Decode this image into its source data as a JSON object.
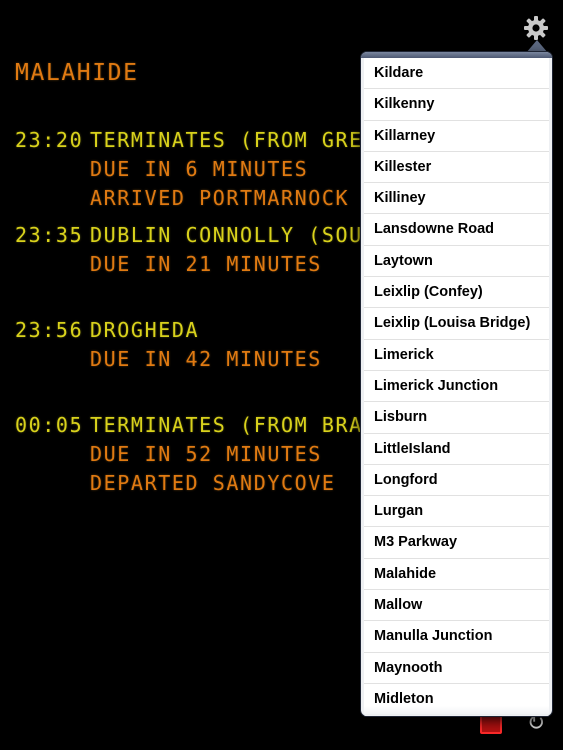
{
  "board": {
    "station": "MALAHIDE",
    "departures": [
      {
        "time": "23:20",
        "destination": "TERMINATES (FROM GREYS",
        "due": "DUE IN 6 MINUTES",
        "status": "ARRIVED PORTMARNOCK"
      },
      {
        "time": "23:35",
        "destination": "DUBLIN CONNOLLY (SOUTH",
        "due": "DUE IN 21 MINUTES",
        "status": ""
      },
      {
        "time": "23:56",
        "destination": "DROGHEDA",
        "due": "DUE IN 42 MINUTES",
        "status": ""
      },
      {
        "time": "00:05",
        "destination": "TERMINATES (FROM BRAY)",
        "due": "DUE IN 52 MINUTES",
        "status": "DEPARTED SANDYCOVE"
      }
    ]
  },
  "icons": {
    "settings": "gear-icon",
    "bottom_left": "board-icon",
    "bottom_right": "refresh-icon"
  },
  "colors": {
    "background": "#000000",
    "time_destination": "#d9d21c",
    "due_status": "#e07a12",
    "station_title": "#e07a12"
  },
  "station_list": {
    "items": [
      "Kildare",
      "Kilkenny",
      "Killarney",
      "Killester",
      "Killiney",
      "Lansdowne Road",
      "Laytown",
      "Leixlip (Confey)",
      "Leixlip (Louisa Bridge)",
      "Limerick",
      "Limerick Junction",
      "Lisburn",
      "LittleIsland",
      "Longford",
      "Lurgan",
      "M3 Parkway",
      "Malahide",
      "Mallow",
      "Manulla Junction",
      "Maynooth",
      "Midleton"
    ]
  }
}
